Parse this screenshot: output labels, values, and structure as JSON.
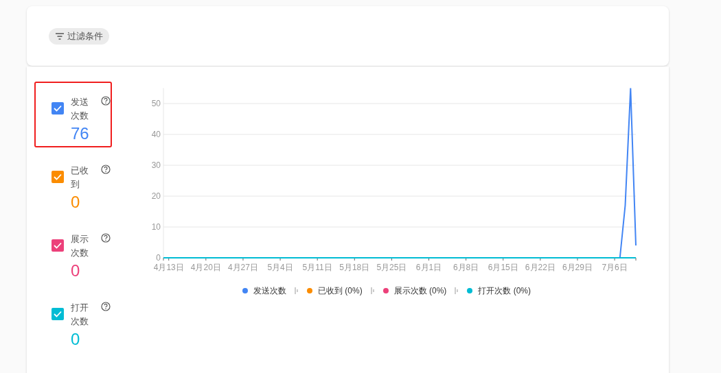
{
  "filter_chip": {
    "label": "过滤条件"
  },
  "metrics": [
    {
      "label": "发送次数",
      "value": "76",
      "checked": true,
      "selected": true,
      "color": "#4285f4"
    },
    {
      "label": "已收到",
      "value": "0",
      "checked": true,
      "selected": false,
      "color": "#fb8c00"
    },
    {
      "label": "展示次数",
      "value": "0",
      "checked": true,
      "selected": false,
      "color": "#ec407a"
    },
    {
      "label": "打开次数",
      "value": "0",
      "checked": true,
      "selected": false,
      "color": "#00bcd4"
    }
  ],
  "chart_data": {
    "type": "line",
    "grid": true,
    "categories": [
      null,
      "4月13日",
      null,
      null,
      null,
      null,
      null,
      null,
      "4月20日",
      null,
      null,
      null,
      null,
      null,
      null,
      "4月27日",
      null,
      null,
      null,
      null,
      null,
      null,
      "5月4日",
      null,
      null,
      null,
      null,
      null,
      null,
      "5月11日",
      null,
      null,
      null,
      null,
      null,
      null,
      "5月18日",
      null,
      null,
      null,
      null,
      null,
      null,
      "5月25日",
      null,
      null,
      null,
      null,
      null,
      null,
      "6月1日",
      null,
      null,
      null,
      null,
      null,
      null,
      "6月8日",
      null,
      null,
      null,
      null,
      null,
      null,
      "6月15日",
      null,
      null,
      null,
      null,
      null,
      null,
      "6月22日",
      null,
      null,
      null,
      null,
      null,
      null,
      "6月29日",
      null,
      null,
      null,
      null,
      null,
      null,
      "7月6日",
      null,
      null,
      null,
      null
    ],
    "series": [
      {
        "name": "发送次数",
        "color": "#4285f4",
        "values": [
          null,
          null,
          null,
          null,
          null,
          null,
          null,
          null,
          null,
          null,
          null,
          null,
          null,
          null,
          null,
          null,
          null,
          null,
          null,
          null,
          null,
          null,
          null,
          null,
          null,
          null,
          null,
          null,
          null,
          null,
          null,
          null,
          null,
          null,
          null,
          null,
          null,
          null,
          null,
          null,
          null,
          null,
          null,
          null,
          null,
          null,
          null,
          null,
          null,
          null,
          null,
          null,
          null,
          null,
          null,
          null,
          null,
          null,
          null,
          null,
          null,
          null,
          null,
          null,
          null,
          null,
          null,
          null,
          null,
          null,
          null,
          null,
          null,
          null,
          null,
          null,
          null,
          null,
          null,
          null,
          null,
          null,
          null,
          null,
          null,
          null,
          0,
          17,
          55,
          4
        ]
      },
      {
        "name": "已收到 (0%)",
        "color": "#fb8c00",
        "values": [
          null,
          null,
          null,
          null,
          null,
          null,
          null,
          null,
          null,
          null,
          null,
          null,
          null,
          null,
          null,
          null,
          null,
          null,
          null,
          null,
          null,
          null,
          null,
          null,
          null,
          null,
          null,
          null,
          null,
          null,
          null,
          null,
          null,
          null,
          null,
          null,
          null,
          null,
          null,
          null,
          null,
          null,
          null,
          null,
          null,
          null,
          null,
          null,
          null,
          null,
          null,
          null,
          null,
          null,
          null,
          null,
          null,
          null,
          null,
          null,
          null,
          null,
          null,
          null,
          null,
          null,
          null,
          null,
          null,
          null,
          null,
          null,
          null,
          null,
          null,
          null,
          null,
          null,
          null,
          null,
          null,
          null,
          null,
          null,
          null,
          null,
          null,
          null,
          null,
          null
        ]
      },
      {
        "name": "展示次数 (0%)",
        "color": "#ec407a",
        "values": [
          null,
          null,
          null,
          null,
          null,
          null,
          null,
          null,
          null,
          null,
          null,
          null,
          null,
          null,
          null,
          null,
          null,
          null,
          null,
          null,
          null,
          null,
          null,
          null,
          null,
          null,
          null,
          null,
          null,
          null,
          null,
          null,
          null,
          null,
          null,
          null,
          null,
          null,
          null,
          null,
          null,
          null,
          null,
          null,
          null,
          null,
          null,
          null,
          null,
          null,
          null,
          null,
          null,
          null,
          null,
          null,
          null,
          null,
          null,
          null,
          null,
          null,
          null,
          null,
          null,
          null,
          null,
          null,
          null,
          null,
          null,
          null,
          null,
          null,
          null,
          null,
          null,
          null,
          null,
          null,
          null,
          null,
          null,
          null,
          null,
          null,
          null,
          null,
          null,
          null
        ]
      },
      {
        "name": "打开次数 (0%)",
        "color": "#00bcd4",
        "values": [
          0,
          0,
          0,
          0,
          0,
          0,
          0,
          0,
          0,
          0,
          0,
          0,
          0,
          0,
          0,
          0,
          0,
          0,
          0,
          0,
          0,
          0,
          0,
          0,
          0,
          0,
          0,
          0,
          0,
          0,
          0,
          0,
          0,
          0,
          0,
          0,
          0,
          0,
          0,
          0,
          0,
          0,
          0,
          0,
          0,
          0,
          0,
          0,
          0,
          0,
          0,
          0,
          0,
          0,
          0,
          0,
          0,
          0,
          0,
          0,
          0,
          0,
          0,
          0,
          0,
          0,
          0,
          0,
          0,
          0,
          0,
          0,
          0,
          0,
          0,
          0,
          0,
          0,
          0,
          0,
          0,
          0,
          0,
          0,
          0,
          0,
          0,
          0,
          0,
          0
        ]
      }
    ],
    "ylim": [
      0,
      55
    ],
    "yticks": [
      0,
      10,
      20,
      30,
      40,
      50
    ]
  }
}
